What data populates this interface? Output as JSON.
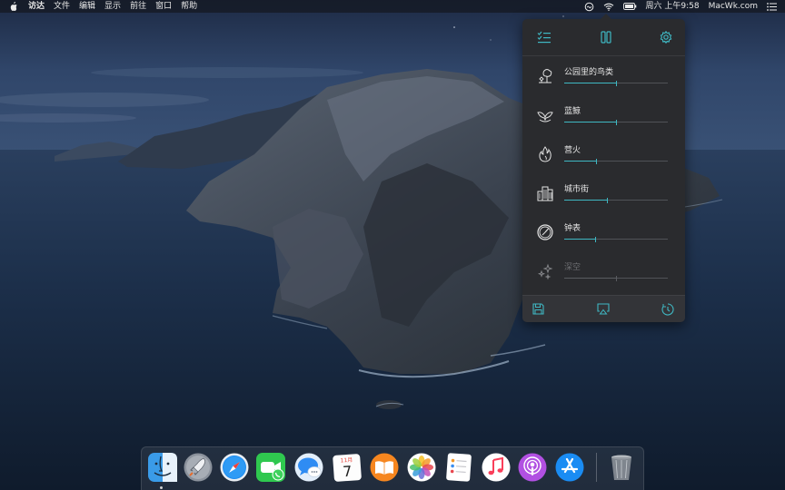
{
  "menubar": {
    "apple_icon": "apple-logo",
    "app_name": "访达",
    "menus": [
      "文件",
      "编辑",
      "显示",
      "前往",
      "窗口",
      "帮助"
    ],
    "status_icons": [
      "noizio-icon",
      "wifi-icon",
      "battery-icon"
    ],
    "datetime": "周六 上午9:58",
    "site_label": "MacWk.com",
    "list_icon": "notification-list-icon"
  },
  "popover": {
    "top_toolbar": {
      "left_icon": "checklist-icon",
      "center_icon": "pause-icon",
      "right_icon": "settings-gear-icon"
    },
    "sounds": [
      {
        "label": "公园里的鸟类",
        "icon": "tree-bird-icon",
        "level": 0.5,
        "enabled": true
      },
      {
        "label": "蓝鲸",
        "icon": "whale-tail-icon",
        "level": 0.5,
        "enabled": true
      },
      {
        "label": "营火",
        "icon": "flame-icon",
        "level": 0.31,
        "enabled": true
      },
      {
        "label": "城市街",
        "icon": "city-buildings-icon",
        "level": 0.41,
        "enabled": true
      },
      {
        "label": "钟表",
        "icon": "clock-icon",
        "level": 0.3,
        "enabled": true
      },
      {
        "label": "深空",
        "icon": "sparkles-icon",
        "level": 0.5,
        "enabled": false
      }
    ],
    "bottom_toolbar": {
      "left_icon": "save-icon",
      "center_icon": "airplay-icon",
      "right_icon": "timer-icon"
    },
    "accent_color": "#3fb8c3"
  },
  "dock": {
    "apps": [
      {
        "name": "finder-icon",
        "running": true
      },
      {
        "name": "launchpad-icon",
        "running": false
      },
      {
        "name": "safari-icon",
        "running": false
      },
      {
        "name": "facetime-icon",
        "running": false
      },
      {
        "name": "messages-icon",
        "running": false
      },
      {
        "name": "calendar-icon",
        "running": false,
        "month": "11月",
        "day": "7"
      },
      {
        "name": "books-icon",
        "running": false
      },
      {
        "name": "photos-icon",
        "running": false
      },
      {
        "name": "reminders-icon",
        "running": false
      },
      {
        "name": "music-icon",
        "running": false
      },
      {
        "name": "podcasts-icon",
        "running": false
      },
      {
        "name": "app-store-icon",
        "running": false
      },
      {
        "name": "trash-icon",
        "running": false
      }
    ]
  }
}
